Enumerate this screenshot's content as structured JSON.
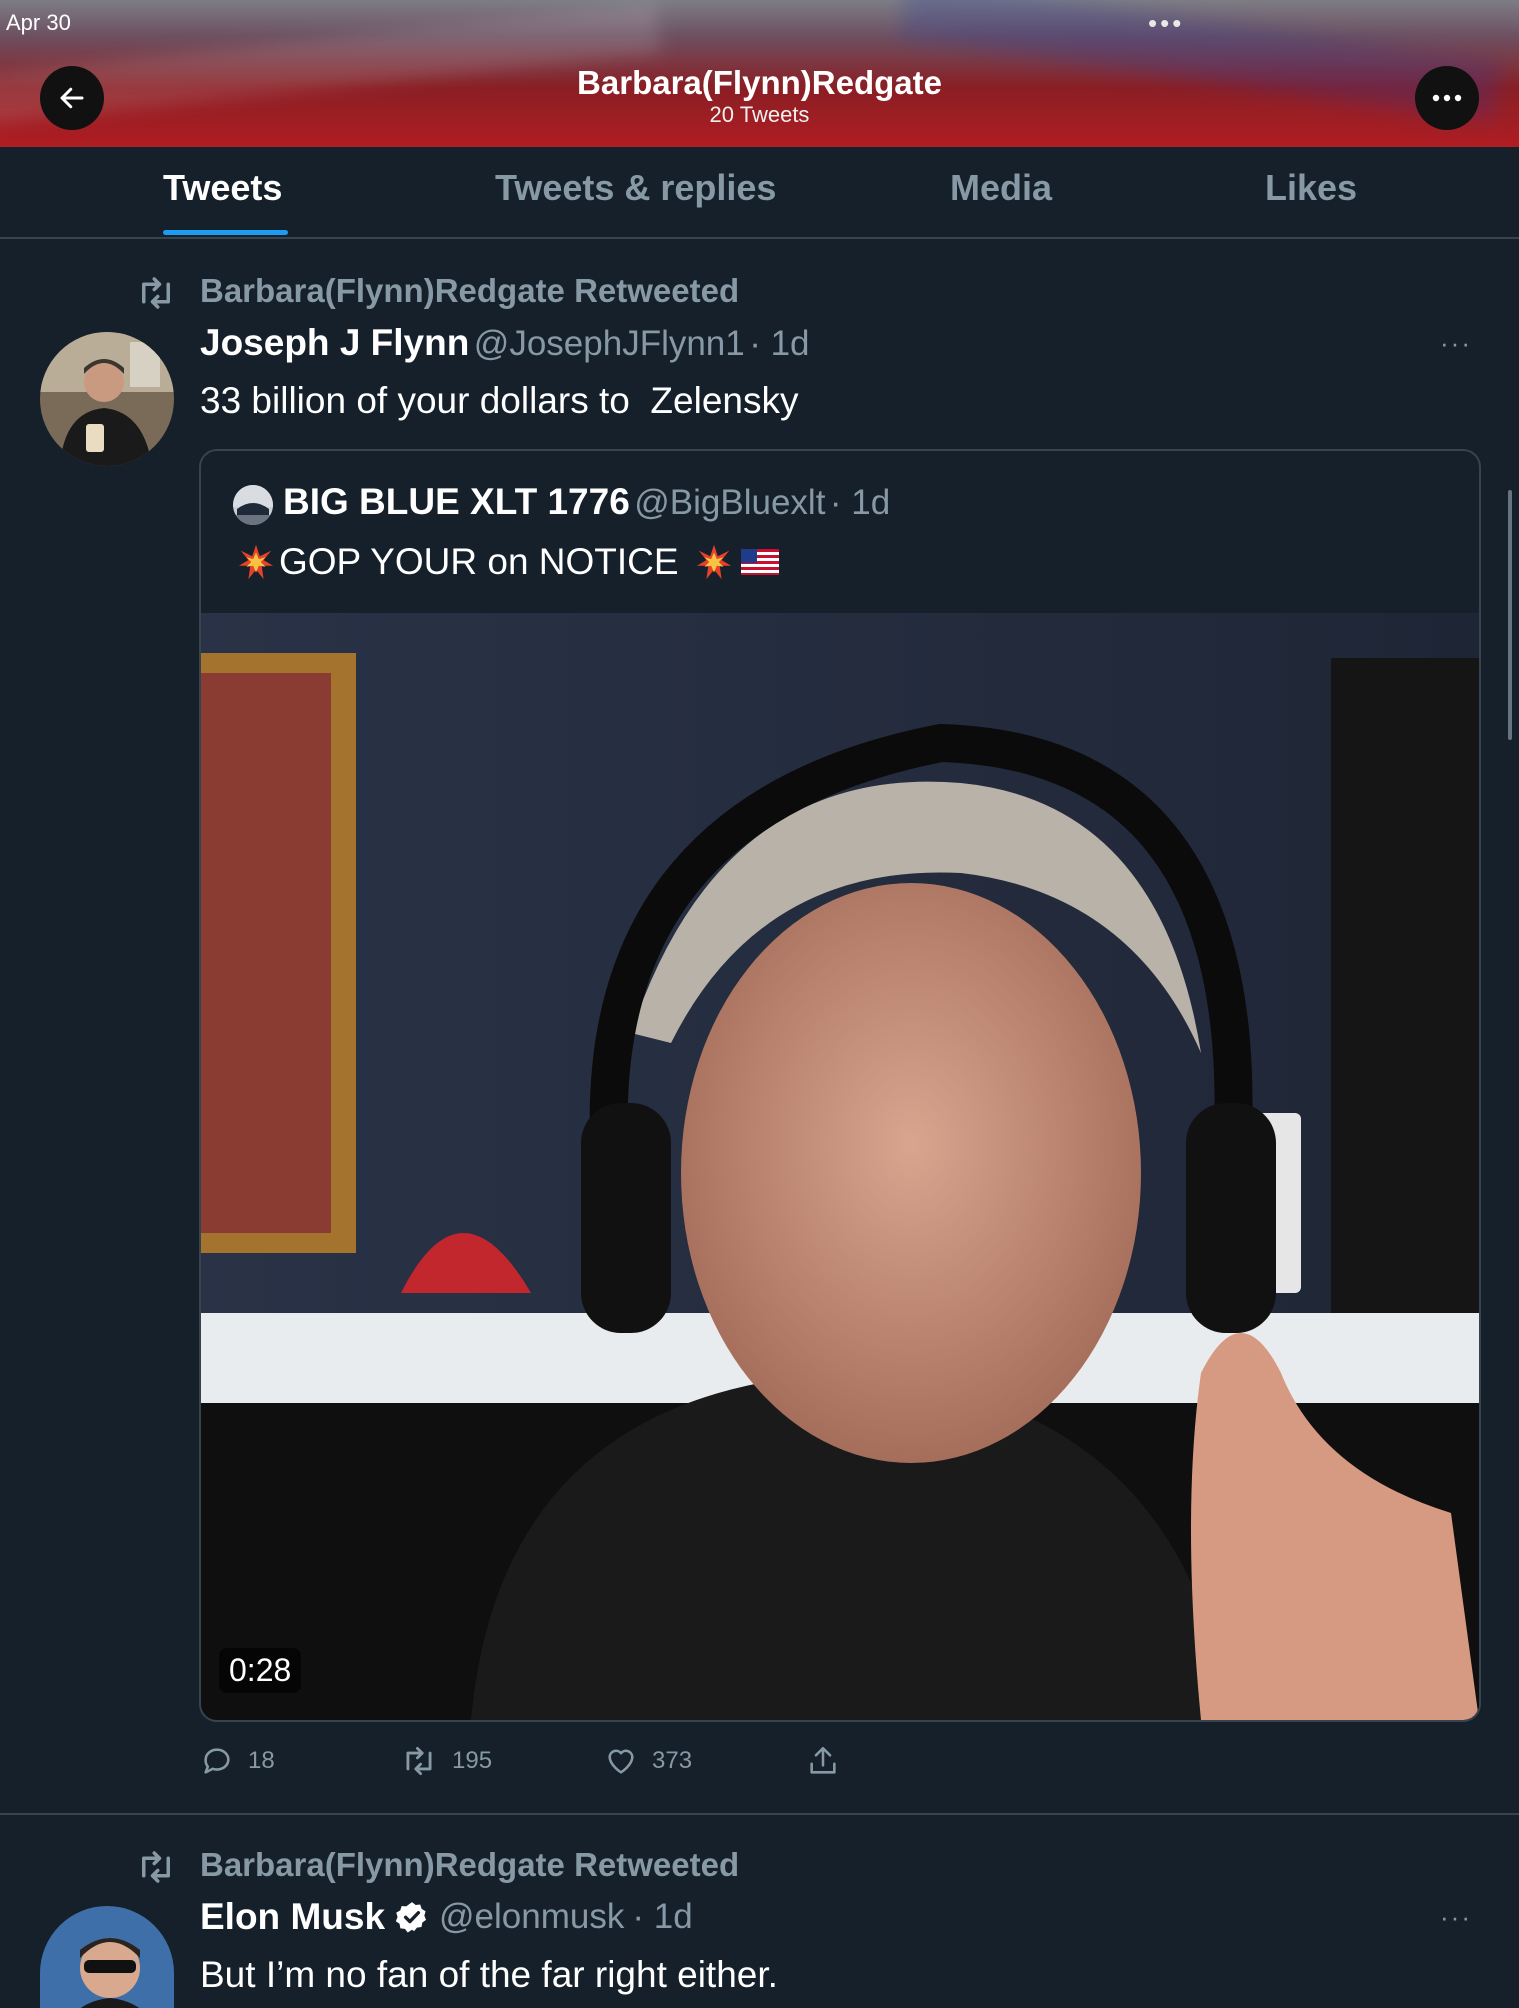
{
  "status_bar": {
    "date": "Apr 30",
    "dots": "•••"
  },
  "header": {
    "name": "Barbara(Flynn)Redgate",
    "tweet_count": "20 Tweets"
  },
  "tabs": [
    {
      "label": "Tweets",
      "active": true
    },
    {
      "label": "Tweets & replies",
      "active": false
    },
    {
      "label": "Media",
      "active": false
    },
    {
      "label": "Likes",
      "active": false
    }
  ],
  "tweets": [
    {
      "retweeted_by": "Barbara(Flynn)Redgate Retweeted",
      "author": "Joseph J Flynn",
      "handle": "@JosephJFlynn1",
      "time": "· 1d",
      "text": "33 billion of your dollars to  Zelensky",
      "more": "···",
      "quote": {
        "author": "BIG BLUE XLT 1776",
        "handle": "@BigBluexlt",
        "time": "· 1d",
        "text": "GOP YOUR on NOTICE",
        "video_duration": "0:28"
      },
      "actions": {
        "replies": "18",
        "retweets": "195",
        "likes": "373"
      }
    },
    {
      "retweeted_by": "Barbara(Flynn)Redgate Retweeted",
      "author": "Elon Musk",
      "handle": "@elonmusk",
      "time": "· 1d",
      "text": "But I’m no fan of the far right either.",
      "more": "···"
    }
  ],
  "icons": {
    "back": "arrow-left-icon",
    "more": "more-horizontal-icon",
    "retweet": "retweet-icon",
    "reply": "reply-icon",
    "like": "heart-icon",
    "share": "share-icon",
    "verified": "verified-badge-icon"
  },
  "colors": {
    "background": "#15202b",
    "accent": "#1d9bf0",
    "muted": "#8899a6",
    "border": "#38444d"
  }
}
